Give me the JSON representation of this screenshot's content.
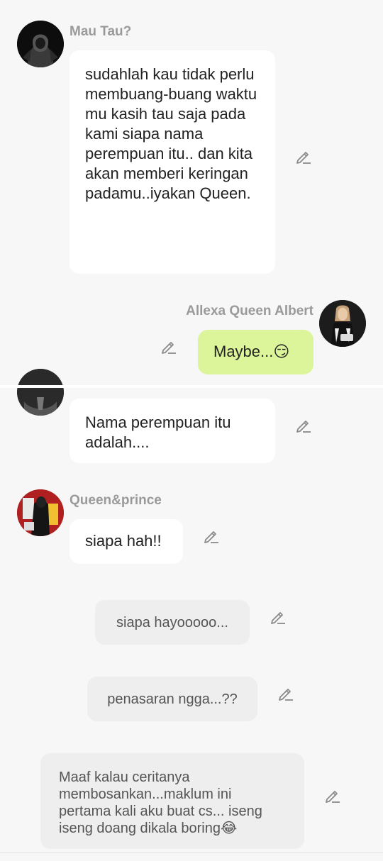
{
  "colors": {
    "background": "#f7f7f7",
    "bubble_white": "#ffffff",
    "bubble_green": "#dcf59a",
    "bubble_gray": "#eeeeee",
    "sender_name": "#9a9a9a",
    "icon": "#8a8a8a"
  },
  "messages": [
    {
      "sender": "Mau Tau?",
      "text": "sudahlah kau tidak perlu membuang-buang waktu mu kasih tau saja pada kami siapa nama perempuan itu.. dan kita akan memberi keringan padamu..iyakan Queen.",
      "avatar_icon": "hooded-figure-avatar",
      "edit_icon": "pencil-icon"
    },
    {
      "sender": "Allexa Queen Albert",
      "text": "Maybe...😏",
      "avatar_icon": "woman-avatar",
      "edit_icon": "pencil-icon"
    },
    {
      "sender": "",
      "text": "Nama perempuan itu adalah....",
      "avatar_icon": "partial-avatar",
      "edit_icon": "pencil-icon"
    },
    {
      "sender": "Queen&prince",
      "text": "siapa hah!!",
      "avatar_icon": "couple-avatar",
      "edit_icon": "pencil-icon"
    },
    {
      "sender": "",
      "text": "siapa hayooooo...",
      "edit_icon": "pencil-icon"
    },
    {
      "sender": "",
      "text": "penasaran ngga...??",
      "edit_icon": "pencil-icon"
    },
    {
      "sender": "",
      "text": "Maaf kalau ceritanya membosankan...maklum ini pertama kali aku buat cs... iseng iseng doang dikala boring😂",
      "edit_icon": "pencil-icon"
    }
  ]
}
